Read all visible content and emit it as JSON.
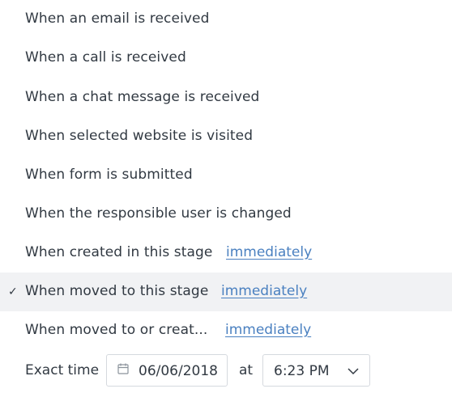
{
  "menu": {
    "items": [
      {
        "label": "When an email is received"
      },
      {
        "label": "When a call is received"
      },
      {
        "label": "When a chat message is received"
      },
      {
        "label": "When selected website is visited"
      },
      {
        "label": "When form is submitted"
      },
      {
        "label": "When the responsible user is changed"
      },
      {
        "label": "When created in this stage",
        "link": "immediately"
      },
      {
        "label": "When moved to this stage",
        "link": "immediately",
        "selected": true,
        "check": "✓"
      },
      {
        "label": "When moved to or creat...",
        "link": "immediately"
      }
    ],
    "exact_time": {
      "label": "Exact time",
      "date_value": "06/06/2018",
      "at_label": "at",
      "time_value": "6:23 PM"
    }
  },
  "icons": {
    "calendar": "calendar-icon",
    "check": "check-icon",
    "chevron": "chevron-down-icon"
  },
  "colors": {
    "text": "#313942",
    "link": "#4a80c0",
    "selected_bg": "#f1f2f4",
    "border": "#d5d9de"
  }
}
